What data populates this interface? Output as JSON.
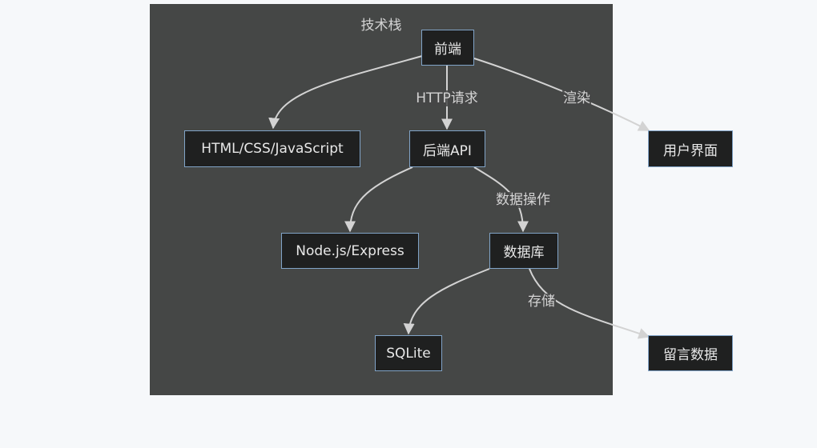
{
  "cluster": {
    "title": "技术栈"
  },
  "nodes": {
    "frontend": "前端",
    "html": "HTML/CSS/JavaScript",
    "backend": "后端API",
    "ui": "用户界面",
    "node": "Node.js/Express",
    "db": "数据库",
    "sqlite": "SQLite",
    "messages": "留言数据"
  },
  "edges": {
    "http": "HTTP请求",
    "render": "渲染",
    "data_op": "数据操作",
    "store": "存储"
  },
  "colors": {
    "background": "#f6f8fa",
    "cluster_fill": "#454746",
    "node_fill": "#1f2020",
    "node_border": "#81a4c8",
    "edge": "#d3d3d3"
  }
}
